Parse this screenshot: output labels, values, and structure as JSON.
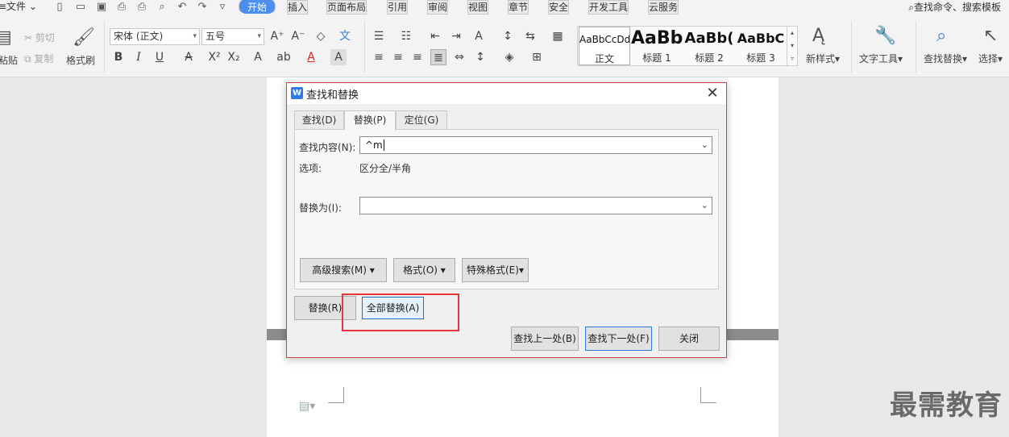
{
  "menubar": {
    "file": "文件",
    "tabs": [
      "开始",
      "插入",
      "页面布局",
      "引用",
      "审阅",
      "视图",
      "章节",
      "安全",
      "开发工具",
      "云服务"
    ],
    "search": "查找命令、搜索模板"
  },
  "ribbon": {
    "paste": "粘贴",
    "cut": "剪切",
    "copy": "复制",
    "format_painter": "格式刷",
    "font": "宋体 (正文)",
    "size": "五号",
    "styles": [
      {
        "sample": "AaBbCcDd",
        "label": "正文"
      },
      {
        "sample": "AaBb",
        "label": "标题 1"
      },
      {
        "sample": "AaBb(",
        "label": "标题 2"
      },
      {
        "sample": "AaBbC",
        "label": "标题 3"
      }
    ],
    "new_style": "新样式",
    "text_tools": "文字工具",
    "find_replace": "查找替换",
    "select": "选择"
  },
  "dialog": {
    "title": "查找和替换",
    "tabs": [
      "查找(D)",
      "替换(P)",
      "定位(G)"
    ],
    "find_label": "查找内容(N):",
    "find_value": "^m",
    "options_label": "选项:",
    "options_value": "区分全/半角",
    "replace_label": "替换为(I):",
    "replace_value": "",
    "advanced_search": "高级搜索(M)",
    "format": "格式(O)",
    "special_format": "特殊格式(E)",
    "replace_btn": "替换(R)",
    "replace_all_btn": "全部替换(A)",
    "find_prev_btn": "查找上一处(B)",
    "find_next_btn": "查找下一处(F)",
    "close_btn": "关闭"
  },
  "watermark": "最需教育",
  "colors": {
    "active_tab": "#4b8ef0",
    "highlight_box": "#e8343a",
    "dialog_border": "#cc4444"
  }
}
